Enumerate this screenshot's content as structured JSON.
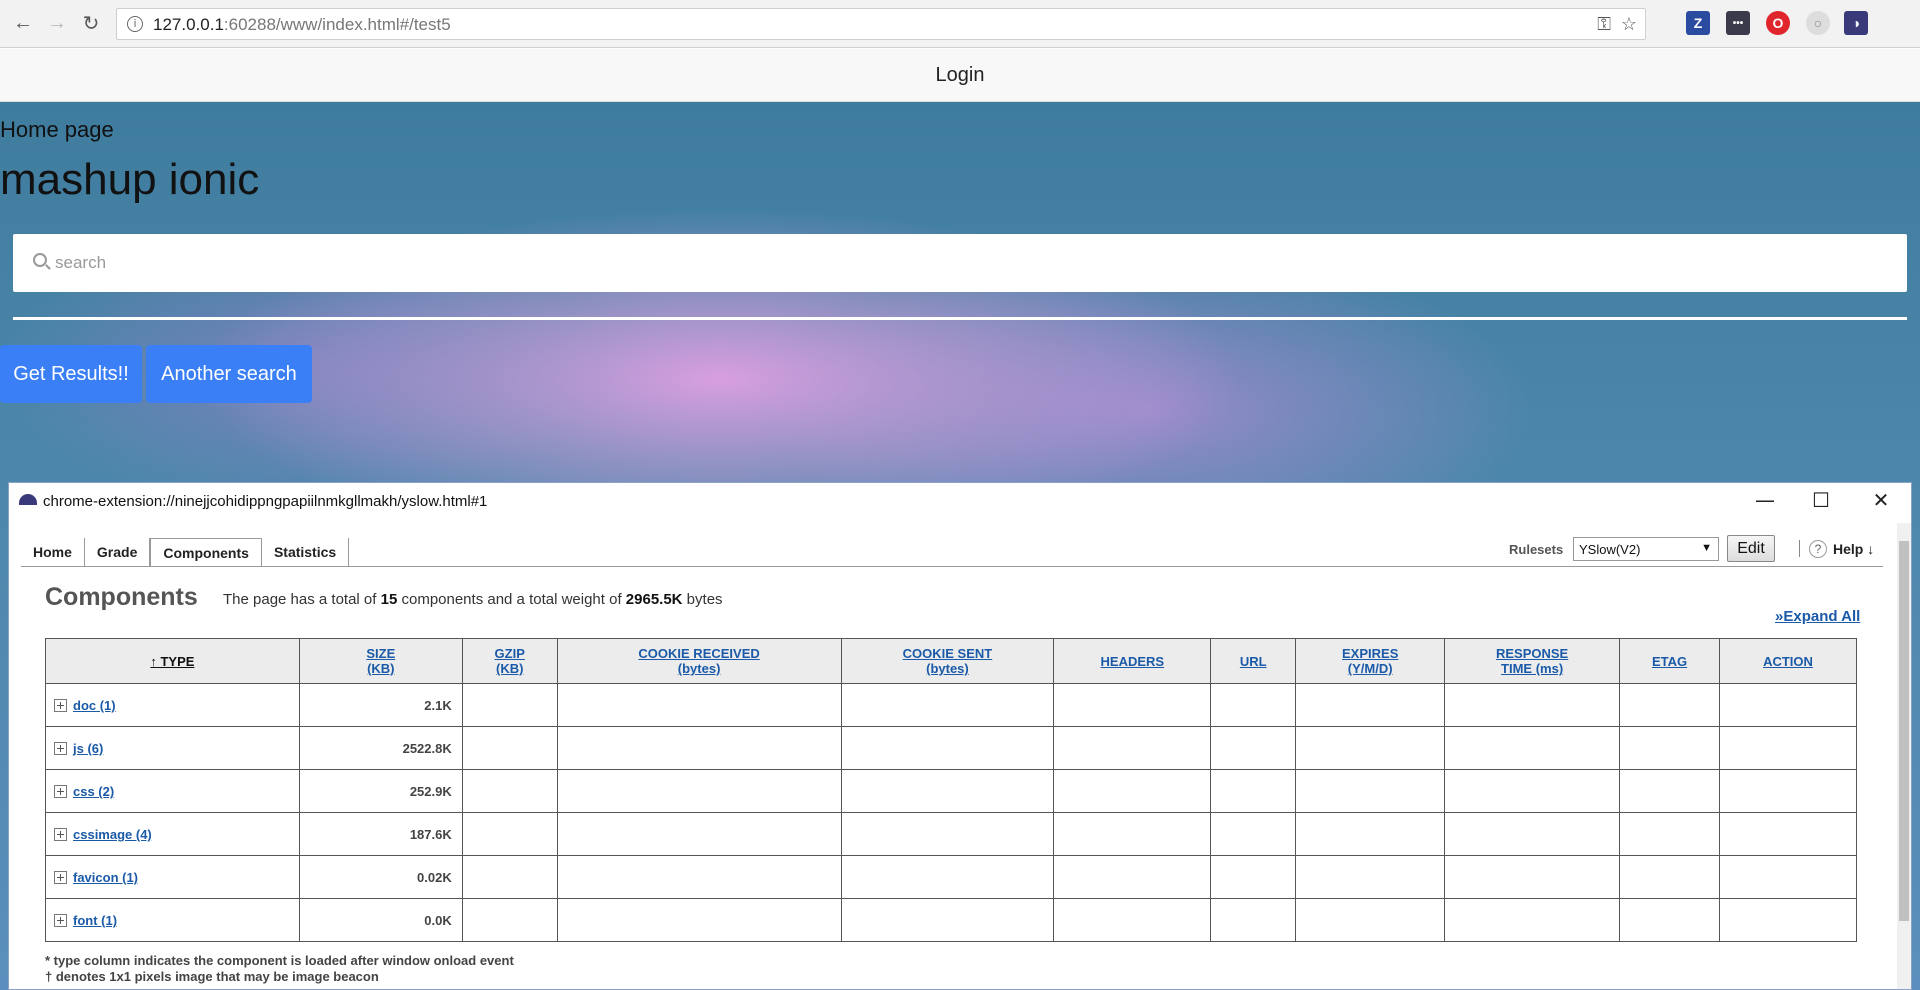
{
  "browser": {
    "url_host": "127.0.0.1",
    "url_rest": ":60288/www/index.html#/test5"
  },
  "page": {
    "nav_title": "Login",
    "breadcrumb": "Home page",
    "title": "mashup ionic",
    "search_placeholder": "search",
    "primary_button": "Get Results!!",
    "secondary_button": "Another search"
  },
  "yslow": {
    "window_url": "chrome-extension://ninejjcohidippngpapiilnmkgllmakh/yslow.html#1",
    "tabs": [
      "Home",
      "Grade",
      "Components",
      "Statistics"
    ],
    "active_tab": "Components",
    "rulesets_label": "Rulesets",
    "rulesets_value": "YSlow(V2)",
    "edit_label": "Edit",
    "help_label": "Help ↓",
    "heading": "Components",
    "summary_pre": "The page has a total of ",
    "summary_count": "15",
    "summary_mid": " components and a total weight of ",
    "summary_weight": "2965.5K",
    "summary_post": " bytes",
    "expand_all": "»Expand All",
    "columns": [
      [
        "↑ TYPE"
      ],
      [
        "SIZE",
        "(KB)"
      ],
      [
        "GZIP",
        "(KB)"
      ],
      [
        "COOKIE RECEIVED",
        "(bytes)"
      ],
      [
        "COOKIE SENT",
        "(bytes)"
      ],
      [
        "HEADERS"
      ],
      [
        "URL"
      ],
      [
        "EXPIRES",
        "(Y/M/D)"
      ],
      [
        "RESPONSE",
        "TIME (ms)"
      ],
      [
        "ETAG"
      ],
      [
        "ACTION"
      ]
    ],
    "rows": [
      {
        "type": "doc (1)",
        "size": "2.1K"
      },
      {
        "type": "js (6)",
        "size": "2522.8K"
      },
      {
        "type": "css (2)",
        "size": "252.9K"
      },
      {
        "type": "cssimage (4)",
        "size": "187.6K"
      },
      {
        "type": "favicon (1)",
        "size": "0.02K"
      },
      {
        "type": "font (1)",
        "size": "0.0K"
      }
    ],
    "footnote_1": "* type column indicates the component is loaded after window onload event",
    "footnote_2": "† denotes 1x1 pixels image that may be image beacon"
  }
}
